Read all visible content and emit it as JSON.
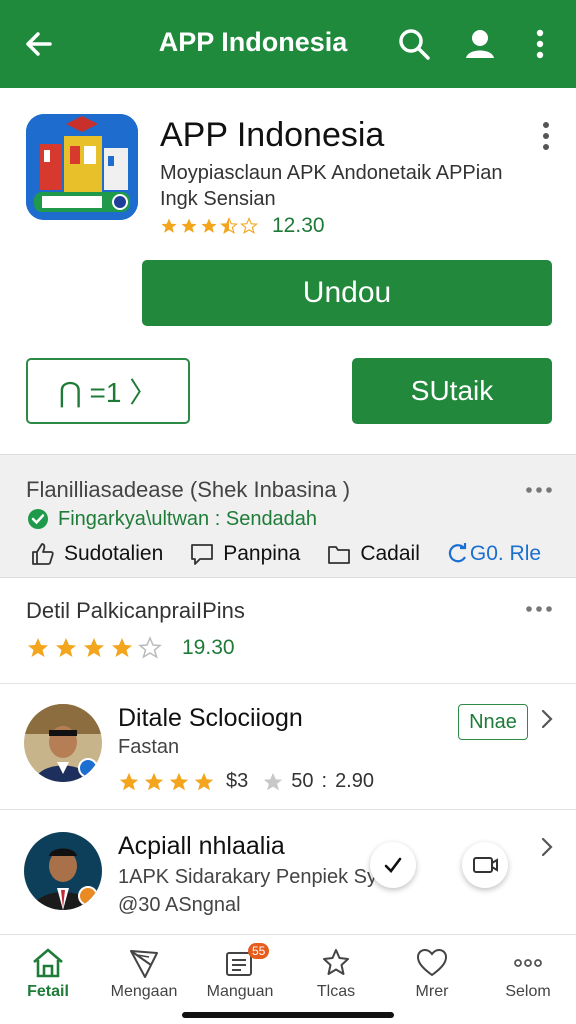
{
  "topbar": {
    "title": "APP Indonesia",
    "back_icon": "arrow-left-icon",
    "search_icon": "search-icon",
    "account_icon": "person-icon",
    "menu_icon": "more-vertical-icon",
    "color": "#1f8a3c"
  },
  "app": {
    "title": "APP Indonesia",
    "description": "Moypiasclaun APK Andonetaik APPian Ingk Sensian",
    "rating_value": "12.30",
    "stars_filled": 3.5,
    "primary_button": "Undou",
    "outline_button": "⋂ =1 〉",
    "secondary_button": "SUtaik"
  },
  "info": {
    "title": "Flanilliasadease (Shek Inbasina )",
    "verified": "Fingarkya\\ultwan : Sendadah",
    "actions": [
      {
        "label": "Sudotalien",
        "icon": "thumb-up-icon"
      },
      {
        "label": "Panpina",
        "icon": "comment-icon"
      },
      {
        "label": "Cadail",
        "icon": "folder-icon"
      },
      {
        "label": "G0. Rle",
        "icon": "share-icon"
      }
    ]
  },
  "details": {
    "title": "Detil PalkicanpraiIPins",
    "rating_value": "19.30",
    "stars_filled": 4
  },
  "items": [
    {
      "title": "Ditale Sclociiogn",
      "subtitle": "Fastan",
      "tag": "Nnae",
      "price": "$3",
      "rating_a": "50",
      "rating_b": "2.90"
    },
    {
      "title": "Acpiall nhlaalia",
      "subtitle": "1APK Sidarakary Penpiek Sy",
      "subtitle2": "@30 ASngnal"
    }
  ],
  "nav": [
    {
      "label": "Fetail",
      "icon": "home-icon",
      "active": true
    },
    {
      "label": "Mengaan",
      "icon": "kite-icon"
    },
    {
      "label": "Manguan",
      "icon": "news-icon",
      "badge": "55"
    },
    {
      "label": "Tlcas",
      "icon": "star-outline-icon"
    },
    {
      "label": "Mrer",
      "icon": "heart-icon"
    },
    {
      "label": "Selom",
      "icon": "more-horizontal-icon"
    }
  ],
  "colors": {
    "brand": "#1f8a3c",
    "star": "#f2a51d",
    "link": "#1b6fd1"
  }
}
